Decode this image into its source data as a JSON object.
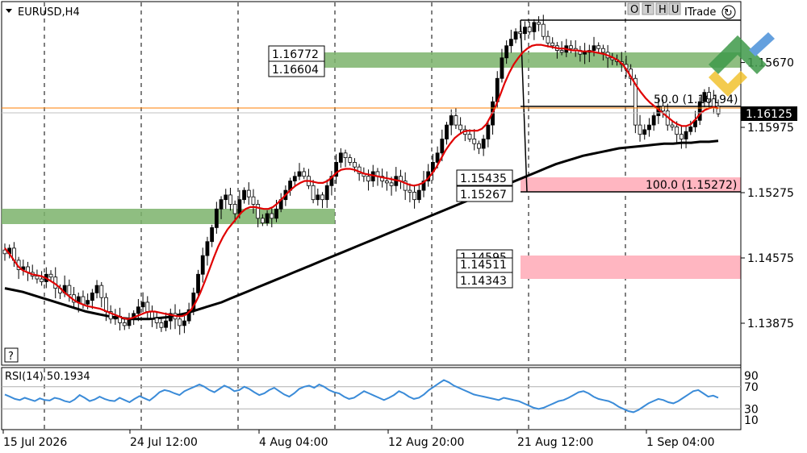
{
  "symbol": "EURUSD,H4",
  "help_glyph": "?",
  "toolbar": {
    "o": "O",
    "t": "T",
    "h": "H",
    "u": "U",
    "trade_label": "ITrade",
    "refresh_glyph": "↻"
  },
  "colors": {
    "candle": "#000000",
    "ma_fast": "#e00000",
    "ma_slow": "#000000",
    "rsi_line": "#3a8bd8",
    "supply_zone": "#7bb36b",
    "demand_zone": "#ffb6c1",
    "bid_line": "#ff7f00",
    "logo_green": "#3f9a4a",
    "logo_blue": "#4a90d9",
    "logo_yellow": "#f2c230"
  },
  "zone_labels": {
    "upper_high": "1.16772",
    "upper_low": "1.16604",
    "mid_high": "1.15435",
    "mid_low": "1.15267",
    "lower_high": "1.14595",
    "lower_mid": "1.14511",
    "lower_low": "1.14343"
  },
  "fibo": {
    "level_50": "50.0 (1.16194)",
    "level_100": "100.0 (1.15272)"
  },
  "current_price": "1.16125",
  "rsi_label": "RSI(14) 50.1934",
  "chart_data": [
    {
      "type": "candlestick",
      "title": "EURUSD,H4",
      "y_ticks": [
        1.1667,
        1.15975,
        1.15275,
        1.14575,
        1.13875
      ],
      "y_tick_labels": [
        "1.15670",
        "1.15975",
        "1.15275",
        "1.14575",
        "1.13875"
      ],
      "ylim": [
        1.1335,
        1.1785
      ],
      "x_tick_labels": [
        "15 Jul 2026",
        "24 Jul 12:00",
        "4 Aug 04:00",
        "12 Aug 20:00",
        "21 Aug 12:00",
        "1 Sep 04:00"
      ],
      "series": [
        {
          "values": [
            1.1462,
            1.1468,
            1.1455,
            1.1445,
            1.1448,
            1.1442,
            1.1438,
            1.1435,
            1.1432,
            1.144,
            1.1437,
            1.1425,
            1.142,
            1.1428,
            1.1418,
            1.141,
            1.1416,
            1.1408,
            1.1412,
            1.142,
            1.1428,
            1.1415,
            1.14,
            1.1392,
            1.1395,
            1.1388,
            1.1385,
            1.1392,
            1.1398,
            1.1405,
            1.141,
            1.14,
            1.1393,
            1.1388,
            1.1383,
            1.139,
            1.1398,
            1.1392,
            1.1385,
            1.139,
            1.1402,
            1.142,
            1.144,
            1.146,
            1.1475,
            1.149,
            1.151,
            1.152,
            1.1525,
            1.1515,
            1.1505,
            1.152,
            1.153,
            1.1523,
            1.1515,
            1.15,
            1.1495,
            1.1505,
            1.15,
            1.151,
            1.152,
            1.153,
            1.154,
            1.1545,
            1.155,
            1.1545,
            1.1535,
            1.152,
            1.1525,
            1.152,
            1.1535,
            1.1545,
            1.156,
            1.157,
            1.1565,
            1.156,
            1.1555,
            1.1548,
            1.1545,
            1.154,
            1.155,
            1.1545,
            1.154,
            1.1538,
            1.1535,
            1.1545,
            1.154,
            1.153,
            1.1528,
            1.152,
            1.153,
            1.154,
            1.155,
            1.156,
            1.157,
            1.1585,
            1.16,
            1.161,
            1.16,
            1.1595,
            1.159,
            1.1585,
            1.158,
            1.1575,
            1.1585,
            1.16,
            1.1625,
            1.165,
            1.1672,
            1.1685,
            1.1692,
            1.17,
            1.1698,
            1.1705,
            1.17,
            1.171,
            1.1708,
            1.1695,
            1.1688,
            1.1685,
            1.168,
            1.1678,
            1.1685,
            1.1682,
            1.168,
            1.1676,
            1.1678,
            1.168,
            1.1685,
            1.1682,
            1.1678,
            1.1672,
            1.167,
            1.1668,
            1.1665,
            1.166,
            1.165,
            1.16,
            1.159,
            1.1595,
            1.16,
            1.161,
            1.162,
            1.1615,
            1.16,
            1.1598,
            1.159,
            1.1585,
            1.1593,
            1.1598,
            1.1605,
            1.1625,
            1.1635,
            1.1628,
            1.162,
            1.1612
          ],
          "name": ""
        },
        {
          "name": "",
          "values": [
            1.1468,
            1.1462,
            1.1455,
            1.1448,
            1.1444,
            1.1442,
            1.144,
            1.1439,
            1.1438,
            1.1436,
            1.1433,
            1.143,
            1.1426,
            1.1421,
            1.1417,
            1.1413,
            1.141,
            1.1408,
            1.1406,
            1.1405,
            1.1404,
            1.1403,
            1.1401,
            1.1399,
            1.1397,
            1.1395,
            1.1393,
            1.1392,
            1.1393,
            1.1395,
            1.1397,
            1.1399,
            1.14,
            1.14,
            1.1399,
            1.1398,
            1.1397,
            1.1396,
            1.1395,
            1.1395,
            1.1397,
            1.1402,
            1.141,
            1.142,
            1.1432,
            1.1445,
            1.1458,
            1.147,
            1.148,
            1.1488,
            1.1494,
            1.15,
            1.1506,
            1.151,
            1.1512,
            1.1512,
            1.1511,
            1.151,
            1.151,
            1.1512,
            1.1516,
            1.1521,
            1.1526,
            1.1531,
            1.1535,
            1.1538,
            1.154,
            1.154,
            1.1539,
            1.1538,
            1.1538,
            1.154,
            1.1544,
            1.1549,
            1.1552,
            1.1553,
            1.1553,
            1.1552,
            1.155,
            1.1548,
            1.1547,
            1.1546,
            1.1545,
            1.1544,
            1.1543,
            1.1542,
            1.1541,
            1.154,
            1.1538,
            1.1536,
            1.1535,
            1.1536,
            1.1538,
            1.1542,
            1.1548,
            1.1555,
            1.1564,
            1.1573,
            1.158,
            1.1586,
            1.159,
            1.1593,
            1.1594,
            1.1594,
            1.1594,
            1.1596,
            1.1601,
            1.161,
            1.162,
            1.1632,
            1.1645,
            1.1656,
            1.1665,
            1.1672,
            1.1678,
            1.1682,
            1.1685,
            1.1686,
            1.1686,
            1.1685,
            1.1684,
            1.1683,
            1.1682,
            1.1682,
            1.1681,
            1.168,
            1.168,
            1.1679,
            1.1679,
            1.1679,
            1.1678,
            1.1677,
            1.1676,
            1.1674,
            1.1672,
            1.1669,
            1.1665,
            1.1658,
            1.165,
            1.1642,
            1.1635,
            1.1629,
            1.1624,
            1.162,
            1.1616,
            1.1612,
            1.1608,
            1.1604,
            1.1601,
            1.1599,
            1.1599,
            1.1601,
            1.1606,
            1.1612,
            1.1616,
            1.1618,
            1.1619,
            1.1618
          ]
        },
        {
          "name": "",
          "values": [
            1.1425,
            1.1423,
            1.1421,
            1.1418,
            1.1415,
            1.1412,
            1.1409,
            1.1406,
            1.1403,
            1.14,
            1.1398,
            1.1396,
            1.1394,
            1.1393,
            1.1392,
            1.1392,
            1.1392,
            1.1393,
            1.1394,
            1.1396,
            1.1398,
            1.1401,
            1.1404,
            1.1407,
            1.141,
            1.1414,
            1.1418,
            1.1422,
            1.1426,
            1.143,
            1.1434,
            1.1438,
            1.1442,
            1.1446,
            1.145,
            1.1454,
            1.1458,
            1.1462,
            1.1466,
            1.147,
            1.1474,
            1.1478,
            1.1482,
            1.1486,
            1.149,
            1.1494,
            1.1498,
            1.1502,
            1.1506,
            1.151,
            1.1514,
            1.1518,
            1.1522,
            1.1526,
            1.153,
            1.1534,
            1.1538,
            1.1542,
            1.1546,
            1.155,
            1.1554,
            1.1558,
            1.1561,
            1.1564,
            1.1567,
            1.1569,
            1.1571,
            1.1573,
            1.1575,
            1.1576,
            1.1577,
            1.1578,
            1.1579,
            1.158,
            1.158,
            1.1581,
            1.1581,
            1.1582,
            1.1582,
            1.1583
          ]
        }
      ]
    },
    {
      "type": "line",
      "title": "RSI(14) 50.1934",
      "y_ticks": [
        90,
        70,
        30,
        10
      ],
      "ylim": [
        0,
        100
      ],
      "series": [
        {
          "values": [
            56,
            52,
            48,
            46,
            50,
            47,
            44,
            49,
            46,
            45,
            50,
            48,
            44,
            42,
            47,
            55,
            50,
            44,
            47,
            52,
            48,
            45,
            44,
            50,
            46,
            42,
            48,
            53,
            49,
            45,
            52,
            60,
            64,
            62,
            58,
            55,
            62,
            66,
            70,
            74,
            70,
            64,
            60,
            66,
            72,
            68,
            62,
            64,
            70,
            66,
            60,
            55,
            58,
            64,
            68,
            62,
            56,
            52,
            58,
            66,
            70,
            72,
            68,
            74,
            70,
            64,
            60,
            58,
            52,
            48,
            50,
            56,
            62,
            58,
            54,
            50,
            46,
            50,
            55,
            62,
            58,
            52,
            48,
            50,
            56,
            64,
            70,
            76,
            82,
            78,
            72,
            68,
            64,
            60,
            56,
            54,
            52,
            50,
            48,
            46,
            50,
            48,
            46,
            44,
            40,
            36,
            32,
            30,
            32,
            36,
            40,
            44,
            46,
            50,
            55,
            60,
            62,
            58,
            52,
            48,
            46,
            44,
            40,
            34,
            30,
            26,
            24,
            28,
            34,
            40,
            44,
            48,
            46,
            42,
            40,
            44,
            50,
            56,
            62,
            64,
            58,
            52,
            54,
            50
          ],
          "name": ""
        }
      ]
    }
  ]
}
